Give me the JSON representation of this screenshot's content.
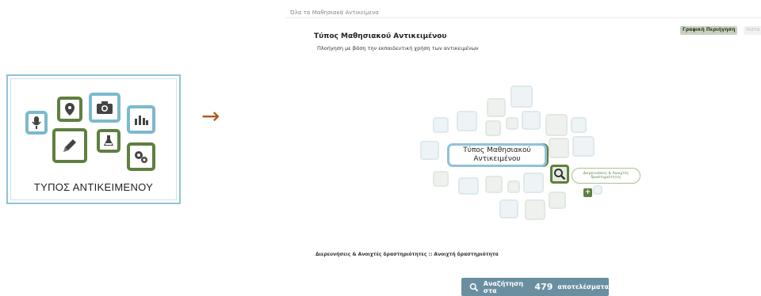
{
  "card": {
    "label": "ΤΥΠΟΣ ΑΝΤΙΚΕΙΜΕΝΟΥ"
  },
  "arrow": "→",
  "panel": {
    "breadcrumb": "Όλα τα Μαθησιακά Αντικείμενα",
    "title": "Τύπος Μαθησιακού Αντικειμένου",
    "subtitle": "Πλοήγηση με βάση την εκπαιδευτική χρήση των αντικειμένων",
    "tabs": [
      "Γραφική Περιήγηση",
      "Λίστα"
    ]
  },
  "cloud": {
    "center_label": "Τύπος Μαθησιακού Αντικειμένου",
    "selected_label": "Διερευνήσεις & Ανοιχτές δραστηριότητες",
    "plus": "+"
  },
  "results": {
    "breadcrumb": "Διερευνήσεις & Ανοιχτές δραστηριότητες :: Ανοιχτή δραστηριότητα",
    "button_prefix": "Αναζήτηση στα",
    "count": "479",
    "button_suffix": "αποτελέσματα"
  },
  "colors": {
    "blue": "#7cb9cf",
    "green": "#5f7f40",
    "button": "#6a8fa0",
    "arrow": "#b0561a"
  }
}
